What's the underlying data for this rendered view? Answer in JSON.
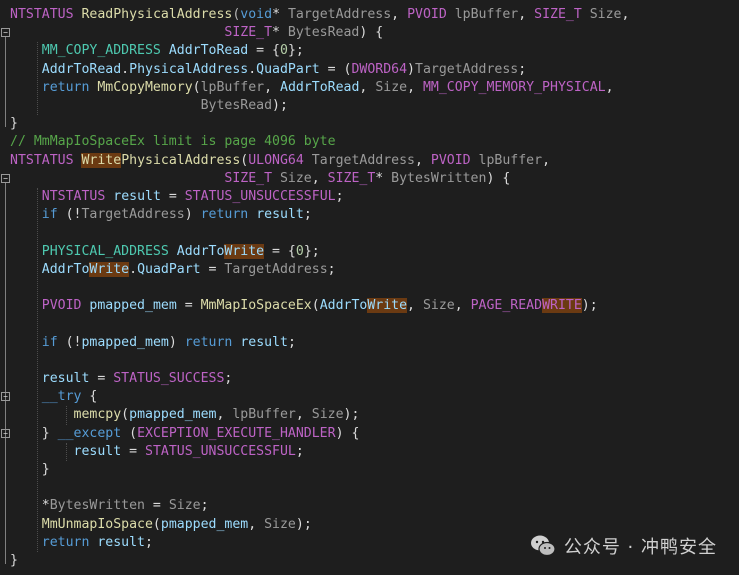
{
  "editor": {
    "lines": [
      {
        "segments": [
          {
            "t": "NTSTATUS",
            "c": "mac"
          },
          {
            "t": " "
          },
          {
            "t": "ReadPhysicalAddress",
            "c": "fn"
          },
          {
            "t": "(",
            "c": "op"
          },
          {
            "t": "void",
            "c": "kw"
          },
          {
            "t": "* "
          },
          {
            "t": "TargetAddress",
            "c": "par"
          },
          {
            "t": ", "
          },
          {
            "t": "PVOID",
            "c": "mac"
          },
          {
            "t": " "
          },
          {
            "t": "lpBuffer",
            "c": "par"
          },
          {
            "t": ", "
          },
          {
            "t": "SIZE_T",
            "c": "mac"
          },
          {
            "t": " "
          },
          {
            "t": "Size",
            "c": "par"
          },
          {
            "t": ","
          }
        ]
      },
      {
        "segments": [
          {
            "t": "                           "
          },
          {
            "t": "SIZE_T",
            "c": "mac"
          },
          {
            "t": "* "
          },
          {
            "t": "BytesRead",
            "c": "par"
          },
          {
            "t": ") {"
          }
        ]
      },
      {
        "segments": [
          {
            "t": "    "
          },
          {
            "t": "MM_COPY_ADDRESS",
            "c": "ty"
          },
          {
            "t": " "
          },
          {
            "t": "AddrToRead",
            "c": "var"
          },
          {
            "t": " = {"
          },
          {
            "t": "0",
            "c": "num"
          },
          {
            "t": "};"
          }
        ]
      },
      {
        "segments": [
          {
            "t": "    "
          },
          {
            "t": "AddrToRead",
            "c": "var"
          },
          {
            "t": "."
          },
          {
            "t": "PhysicalAddress",
            "c": "var"
          },
          {
            "t": "."
          },
          {
            "t": "QuadPart",
            "c": "var"
          },
          {
            "t": " = ("
          },
          {
            "t": "DWORD64",
            "c": "mac"
          },
          {
            "t": ")"
          },
          {
            "t": "TargetAddress",
            "c": "par"
          },
          {
            "t": ";"
          }
        ]
      },
      {
        "segments": [
          {
            "t": "    "
          },
          {
            "t": "return",
            "c": "kw"
          },
          {
            "t": " "
          },
          {
            "t": "MmCopyMemory",
            "c": "fn"
          },
          {
            "t": "("
          },
          {
            "t": "lpBuffer",
            "c": "par"
          },
          {
            "t": ", "
          },
          {
            "t": "AddrToRead",
            "c": "var"
          },
          {
            "t": ", "
          },
          {
            "t": "Size",
            "c": "par"
          },
          {
            "t": ", "
          },
          {
            "t": "MM_COPY_MEMORY_PHYSICAL",
            "c": "mac"
          },
          {
            "t": ","
          }
        ]
      },
      {
        "segments": [
          {
            "t": "                        "
          },
          {
            "t": "BytesRead",
            "c": "par"
          },
          {
            "t": ");"
          }
        ]
      },
      {
        "segments": [
          {
            "t": "}"
          }
        ]
      },
      {
        "segments": [
          {
            "t": "// MmMapIoSpaceEx limit is page 4096 byte",
            "c": "cm"
          }
        ]
      },
      {
        "segments": [
          {
            "t": "NTSTATUS",
            "c": "mac"
          },
          {
            "t": " "
          },
          {
            "t": "Write",
            "c": "fn",
            "h": true
          },
          {
            "t": "PhysicalAddress",
            "c": "fn"
          },
          {
            "t": "("
          },
          {
            "t": "ULONG64",
            "c": "mac"
          },
          {
            "t": " "
          },
          {
            "t": "TargetAddress",
            "c": "par"
          },
          {
            "t": ", "
          },
          {
            "t": "PVOID",
            "c": "mac"
          },
          {
            "t": " "
          },
          {
            "t": "lpBuffer",
            "c": "par"
          },
          {
            "t": ","
          }
        ]
      },
      {
        "segments": [
          {
            "t": "                           "
          },
          {
            "t": "SIZE_T",
            "c": "mac"
          },
          {
            "t": " "
          },
          {
            "t": "Size",
            "c": "par"
          },
          {
            "t": ", "
          },
          {
            "t": "SIZE_T",
            "c": "mac"
          },
          {
            "t": "* "
          },
          {
            "t": "BytesWritten",
            "c": "par"
          },
          {
            "t": ") {"
          }
        ]
      },
      {
        "segments": [
          {
            "t": "    "
          },
          {
            "t": "NTSTATUS",
            "c": "mac"
          },
          {
            "t": " "
          },
          {
            "t": "result",
            "c": "var"
          },
          {
            "t": " = "
          },
          {
            "t": "STATUS_UNSUCCESSFUL",
            "c": "mac"
          },
          {
            "t": ";"
          }
        ]
      },
      {
        "segments": [
          {
            "t": "    "
          },
          {
            "t": "if",
            "c": "kw"
          },
          {
            "t": " (!"
          },
          {
            "t": "TargetAddress",
            "c": "par"
          },
          {
            "t": ") "
          },
          {
            "t": "return",
            "c": "kw"
          },
          {
            "t": " "
          },
          {
            "t": "result",
            "c": "var"
          },
          {
            "t": ";"
          }
        ]
      },
      {
        "segments": [
          {
            "t": ""
          }
        ]
      },
      {
        "segments": [
          {
            "t": "    "
          },
          {
            "t": "PHYSICAL_ADDRESS",
            "c": "ty"
          },
          {
            "t": " "
          },
          {
            "t": "AddrTo",
            "c": "var"
          },
          {
            "t": "Write",
            "c": "var",
            "h": true
          },
          {
            "t": " = {"
          },
          {
            "t": "0",
            "c": "num"
          },
          {
            "t": "};"
          }
        ]
      },
      {
        "segments": [
          {
            "t": "    "
          },
          {
            "t": "AddrTo",
            "c": "var"
          },
          {
            "t": "Write",
            "c": "var",
            "h": true
          },
          {
            "t": "."
          },
          {
            "t": "QuadPart",
            "c": "var"
          },
          {
            "t": " = "
          },
          {
            "t": "TargetAddress",
            "c": "par"
          },
          {
            "t": ";"
          }
        ]
      },
      {
        "segments": [
          {
            "t": ""
          }
        ]
      },
      {
        "segments": [
          {
            "t": "    "
          },
          {
            "t": "PVOID",
            "c": "mac"
          },
          {
            "t": " "
          },
          {
            "t": "pmapped_mem",
            "c": "var"
          },
          {
            "t": " = "
          },
          {
            "t": "MmMapIoSpaceEx",
            "c": "fn"
          },
          {
            "t": "("
          },
          {
            "t": "AddrTo",
            "c": "var"
          },
          {
            "t": "Write",
            "c": "var",
            "h": true
          },
          {
            "t": ", "
          },
          {
            "t": "Size",
            "c": "par"
          },
          {
            "t": ", "
          },
          {
            "t": "PAGE_READ",
            "c": "mac"
          },
          {
            "t": "WRITE",
            "c": "mac",
            "h": true
          },
          {
            "t": ");"
          }
        ]
      },
      {
        "segments": [
          {
            "t": ""
          }
        ]
      },
      {
        "segments": [
          {
            "t": "    "
          },
          {
            "t": "if",
            "c": "kw"
          },
          {
            "t": " (!"
          },
          {
            "t": "pmapped_mem",
            "c": "var"
          },
          {
            "t": ") "
          },
          {
            "t": "return",
            "c": "kw"
          },
          {
            "t": " "
          },
          {
            "t": "result",
            "c": "var"
          },
          {
            "t": ";"
          }
        ]
      },
      {
        "segments": [
          {
            "t": ""
          }
        ]
      },
      {
        "segments": [
          {
            "t": "    "
          },
          {
            "t": "result",
            "c": "var"
          },
          {
            "t": " = "
          },
          {
            "t": "STATUS_SUCCESS",
            "c": "mac"
          },
          {
            "t": ";"
          }
        ]
      },
      {
        "segments": [
          {
            "t": "    "
          },
          {
            "t": "__try",
            "c": "kw"
          },
          {
            "t": " {"
          }
        ]
      },
      {
        "segments": [
          {
            "t": "        "
          },
          {
            "t": "memcpy",
            "c": "fn"
          },
          {
            "t": "("
          },
          {
            "t": "pmapped_mem",
            "c": "var"
          },
          {
            "t": ", "
          },
          {
            "t": "lpBuffer",
            "c": "par"
          },
          {
            "t": ", "
          },
          {
            "t": "Size",
            "c": "par"
          },
          {
            "t": ");"
          }
        ]
      },
      {
        "segments": [
          {
            "t": "    } "
          },
          {
            "t": "__except",
            "c": "kw"
          },
          {
            "t": " ("
          },
          {
            "t": "EXCEPTION_EXECUTE_HANDLER",
            "c": "mac"
          },
          {
            "t": ") {"
          }
        ]
      },
      {
        "segments": [
          {
            "t": "        "
          },
          {
            "t": "result",
            "c": "var"
          },
          {
            "t": " = "
          },
          {
            "t": "STATUS_UNSUCCESSFUL",
            "c": "mac"
          },
          {
            "t": ";"
          }
        ]
      },
      {
        "segments": [
          {
            "t": "    }"
          }
        ]
      },
      {
        "segments": [
          {
            "t": ""
          }
        ]
      },
      {
        "segments": [
          {
            "t": "    *"
          },
          {
            "t": "BytesWritten",
            "c": "par"
          },
          {
            "t": " = "
          },
          {
            "t": "Size",
            "c": "par"
          },
          {
            "t": ";"
          }
        ]
      },
      {
        "segments": [
          {
            "t": "    "
          },
          {
            "t": "MmUnmapIoSpace",
            "c": "fn"
          },
          {
            "t": "("
          },
          {
            "t": "pmapped_mem",
            "c": "var"
          },
          {
            "t": ", "
          },
          {
            "t": "Size",
            "c": "par"
          },
          {
            "t": ");"
          }
        ]
      },
      {
        "segments": [
          {
            "t": "    "
          },
          {
            "t": "return",
            "c": "kw"
          },
          {
            "t": " "
          },
          {
            "t": "result",
            "c": "var"
          },
          {
            "t": ";"
          }
        ]
      },
      {
        "segments": [
          {
            "t": "}"
          }
        ]
      }
    ],
    "fold_markers": [
      {
        "line": 1,
        "symbol": "−"
      },
      {
        "line": 9,
        "symbol": "−"
      },
      {
        "line": 21,
        "symbol": "−"
      },
      {
        "line": 23,
        "symbol": "−"
      }
    ]
  },
  "watermark": {
    "text": "公众号 · 冲鸭安全",
    "icon": "wechat-icon"
  },
  "colors": {
    "background": "#1e1e1e",
    "keyword": "#569cd6",
    "macro": "#bd63c5",
    "function": "#dcdcaa",
    "type": "#4ec9b0",
    "variable": "#9cdcfe",
    "parameter": "#9a9a9a",
    "comment": "#57a64a",
    "highlight": "#6b3a12"
  }
}
